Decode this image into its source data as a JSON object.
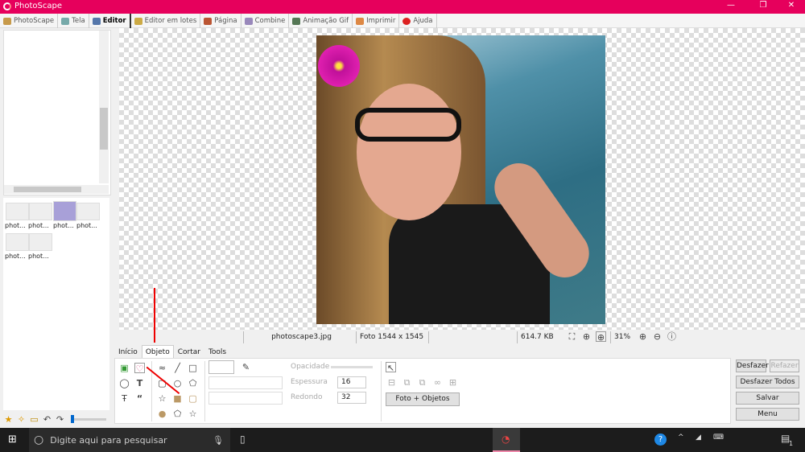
{
  "window": {
    "title": "PhotoScape",
    "controls": [
      "—",
      "❐",
      "✕"
    ]
  },
  "tabs": [
    {
      "label": "PhotoScape"
    },
    {
      "label": "Tela"
    },
    {
      "label": "Editor",
      "active": true
    },
    {
      "label": "Editor em lotes"
    },
    {
      "label": "Página"
    },
    {
      "label": "Combine"
    },
    {
      "label": "Animação Gif"
    },
    {
      "label": "Imprimir"
    },
    {
      "label": "Ajuda"
    }
  ],
  "thumbnails": [
    "phot...",
    "phot...",
    "phot...",
    "phot...",
    "phot...",
    "phot..."
  ],
  "status": {
    "filename": "photoscape3.jpg",
    "dimensions": "Foto 1544 x 1545",
    "size": "614.7 KB",
    "zoom": "31%"
  },
  "bottom_tabs": [
    "Início",
    "Objeto",
    "Cortar",
    "Tools"
  ],
  "panel": {
    "opacity_label": "Opacidade",
    "thickness_label": "Espessura",
    "thickness_value": "16",
    "round_label": "Redondo",
    "round_value": "32",
    "photo_objects_button": "Foto + Objetos"
  },
  "actions": {
    "undo": "Desfazer",
    "redo": "Refazer",
    "undo_all": "Desfazer Todos",
    "save": "Salvar",
    "menu": "Menu"
  },
  "taskbar": {
    "search_placeholder": "Digite aqui para pesquisar",
    "notification_count": "1"
  },
  "colors": {
    "titlebar": "#e6005c",
    "annotation_arrow": "#e00000"
  }
}
